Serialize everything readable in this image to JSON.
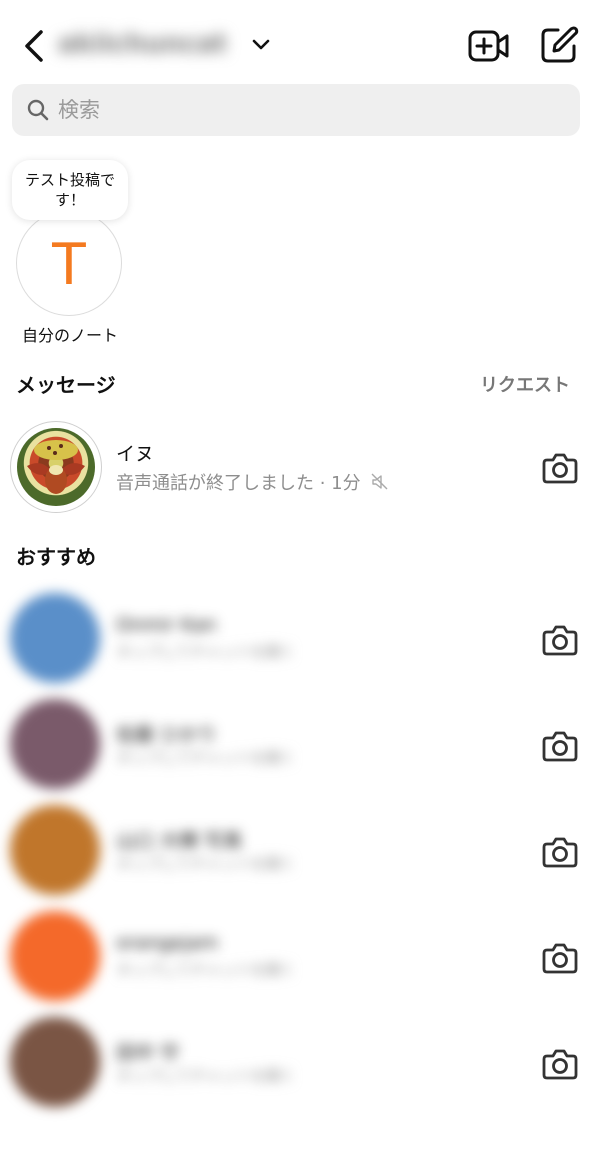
{
  "header": {
    "username": "akiichuncat",
    "icons": {
      "back": "chevron-left-icon",
      "dropdown": "chevron-down-icon",
      "video": "video-plus-icon",
      "compose": "compose-icon"
    }
  },
  "search": {
    "placeholder": "検索",
    "icon": "search-icon"
  },
  "note": {
    "bubble_text": "テスト投稿です！",
    "avatar_letter": "T",
    "label": "自分のノート",
    "accent_color": "#f47a20"
  },
  "messages": {
    "title": "メッセージ",
    "request_label": "リクエスト",
    "threads": [
      {
        "name": "イヌ",
        "subtitle": "音声通話が終了しました · 1分",
        "muted": true,
        "icon": "camera-icon"
      }
    ]
  },
  "suggestions": {
    "title": "おすすめ",
    "items": [
      {
        "name": "Onmir Kan",
        "subtitle": "タップしてチャットを開く",
        "avatar_color": "#5a8fc9"
      },
      {
        "name": "佐藤 ひかり",
        "subtitle": "タップしてチャットを開く",
        "avatar_color": "#7a5a6a"
      },
      {
        "name": "山口 大輝 写真",
        "subtitle": "タップしてチャットを開く",
        "avatar_color": "#c0762b"
      },
      {
        "name": "orangejam",
        "subtitle": "タップしてチャットを開く",
        "avatar_color": "#f4692a"
      },
      {
        "name": "田中 守",
        "subtitle": "タップしてチャットを開く",
        "avatar_color": "#7a5544"
      }
    ]
  }
}
